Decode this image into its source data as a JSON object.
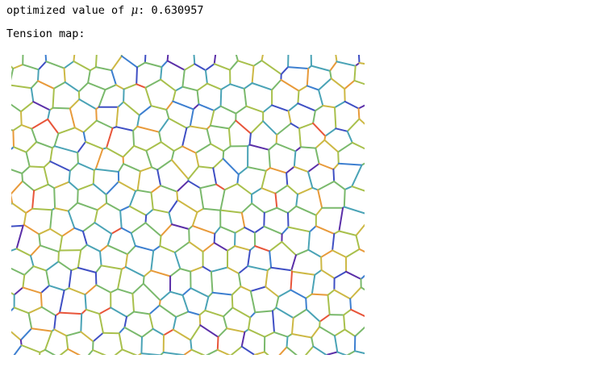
{
  "output": {
    "line1_prefix": "optimized value of ",
    "line1_symbol": "μ",
    "line1_suffix": ": 0.630957",
    "line2": "Tension map:"
  },
  "plot": {
    "edge_palette": [
      "#5b2fa8",
      "#3f4fc4",
      "#3d7fd0",
      "#4aa3b6",
      "#7ab96c",
      "#a8c04c",
      "#cdb844",
      "#e89a3a",
      "#e8553a"
    ],
    "palette_weights": [
      0.03,
      0.06,
      0.07,
      0.16,
      0.26,
      0.2,
      0.12,
      0.06,
      0.04
    ]
  }
}
